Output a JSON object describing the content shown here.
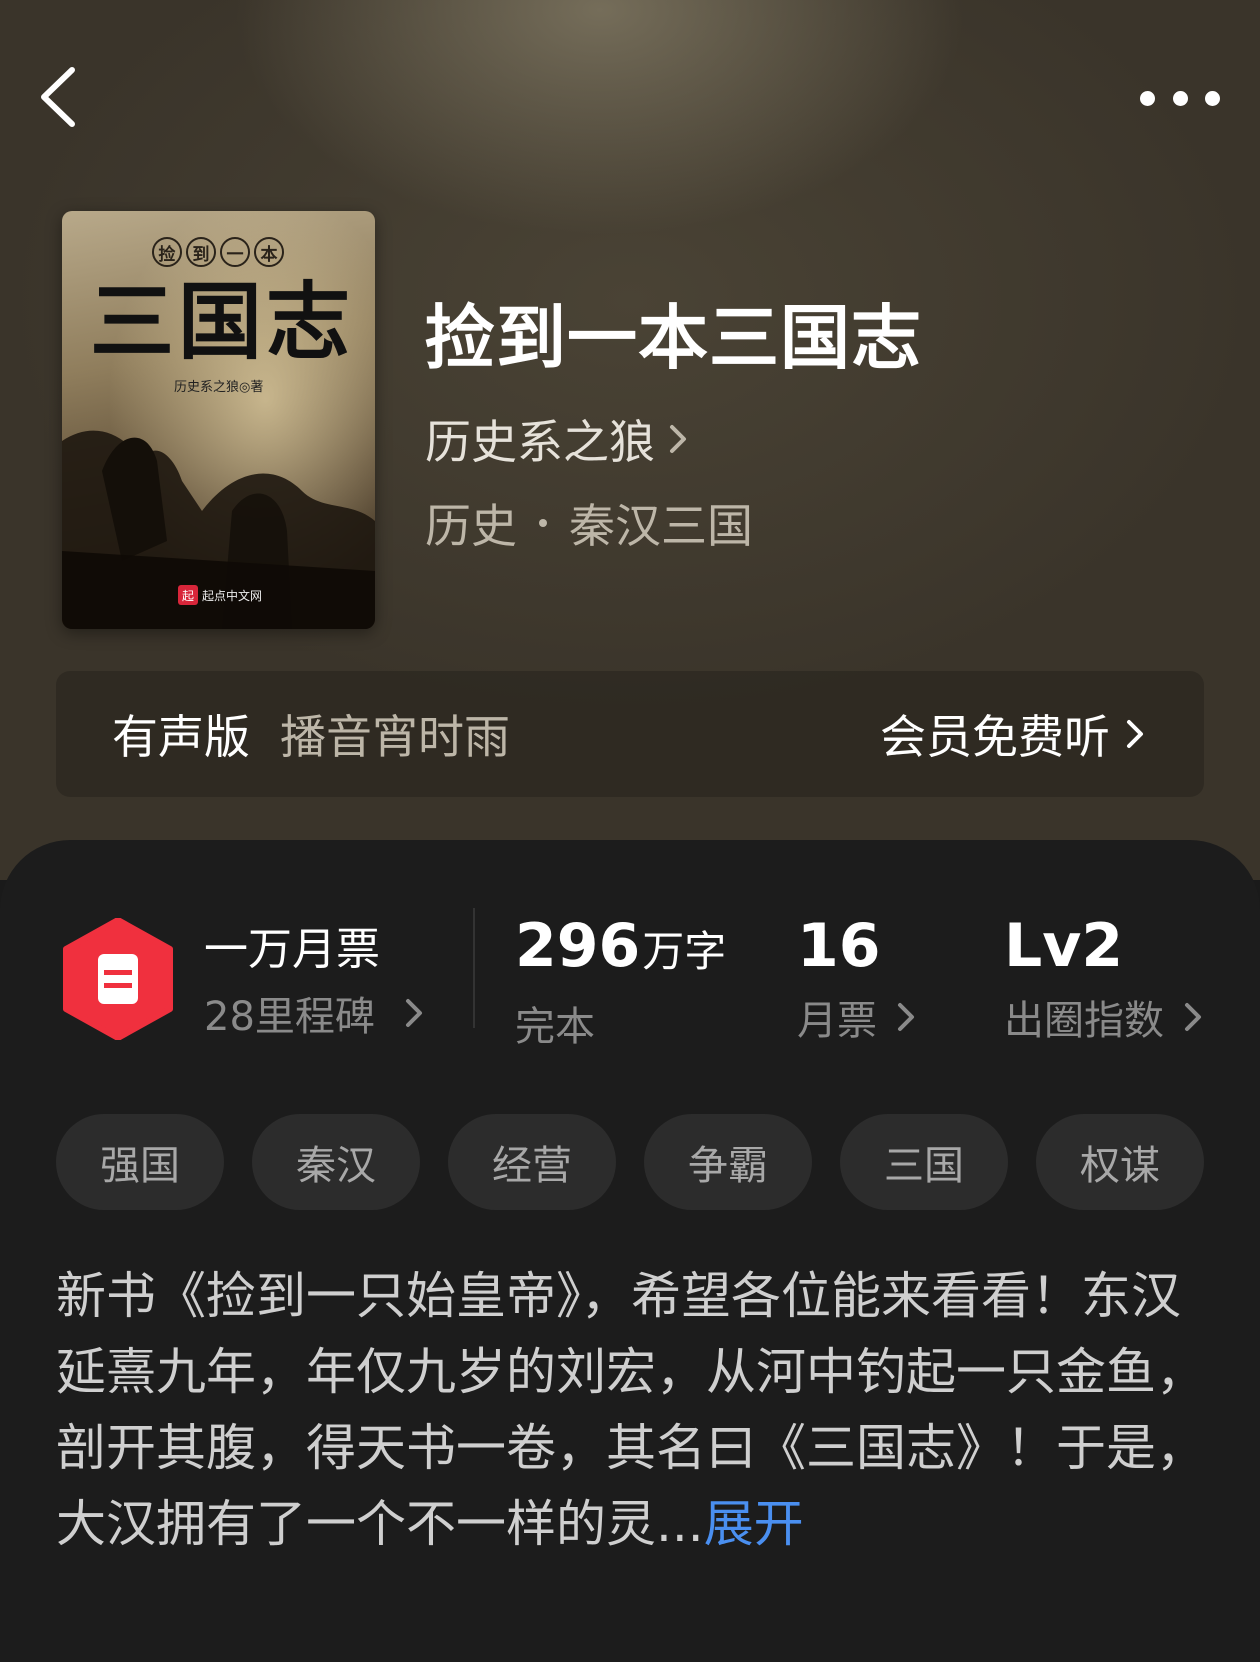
{
  "header": {
    "back_icon": "chevron-left-icon",
    "more_icon": "more-horizontal-icon"
  },
  "book": {
    "cover": {
      "small_title_chars": [
        "捡",
        "到",
        "一",
        "本"
      ],
      "big_title": "三国志",
      "author_line": "历史系之狼◎著",
      "publisher_logo": "起",
      "publisher": "起点中文网"
    },
    "title": "捡到一本三国志",
    "author": "历史系之狼",
    "genre": "历史",
    "subgenre": "秦汉三国"
  },
  "audio": {
    "label": "有声版",
    "narrator": "播音宵时雨",
    "cta": "会员免费听"
  },
  "stats": {
    "primary": {
      "main": "一万月票",
      "sub": "28里程碑"
    },
    "words": {
      "value": "296",
      "unit": "万字",
      "label": "完本"
    },
    "tickets": {
      "value": "16",
      "label": "月票"
    },
    "index": {
      "value": "Lv2",
      "label": "出圈指数"
    }
  },
  "tags": [
    "强国",
    "秦汉",
    "经营",
    "争霸",
    "三国",
    "权谋"
  ],
  "description": {
    "text": "新书《捡到一只始皇帝》，希望各位能来看看！东汉延熹九年，年仅九岁的刘宏，从河中钓起一只金鱼，剖开其腹，得天书一卷，其名曰《三国志》！于是，大汉拥有了一个不一样的灵...",
    "expand": "展开"
  },
  "colors": {
    "accent_link": "#4a8ff0",
    "badge_red": "#f0303e",
    "sheet_bg": "#1c1c1c"
  }
}
